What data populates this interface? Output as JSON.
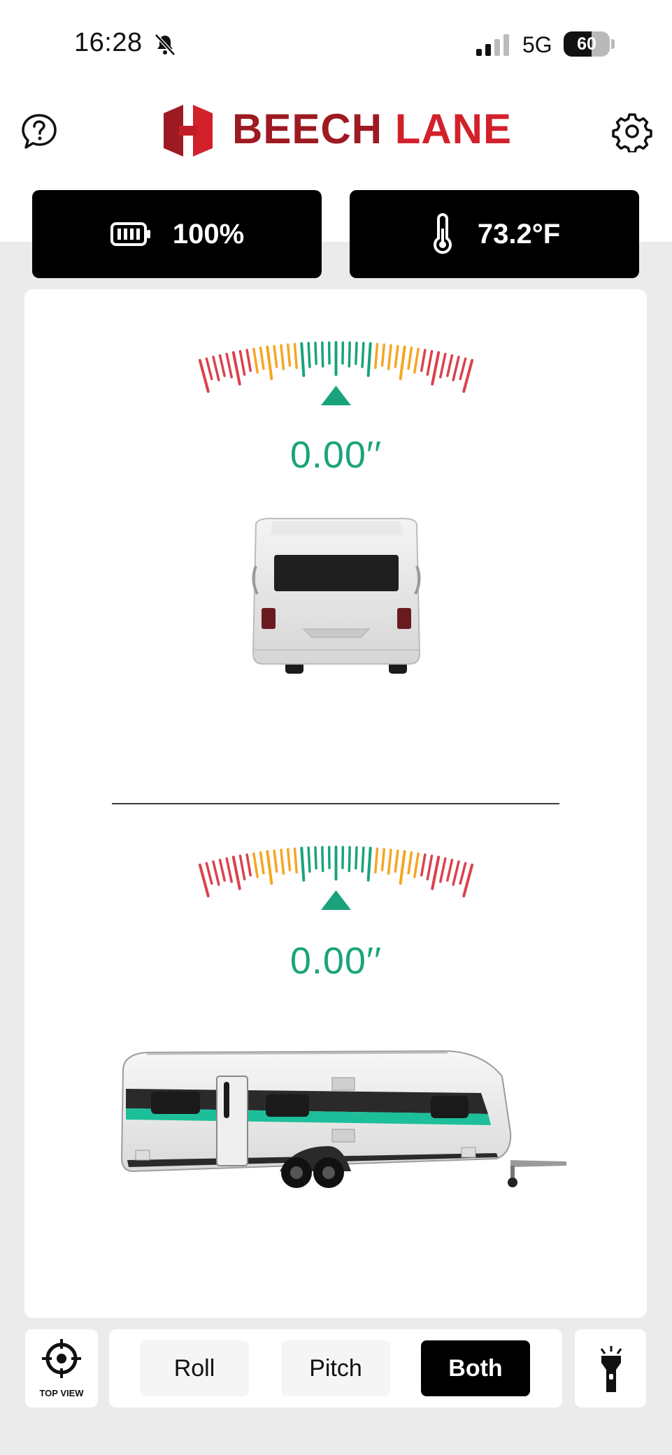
{
  "status_bar": {
    "time": "16:28",
    "network": "5G",
    "battery_level": "60",
    "battery_fraction": 0.6
  },
  "header": {
    "brand_part1": "BEECH",
    "brand_part2": "LANE"
  },
  "stats": {
    "battery": "100%",
    "temperature": "73.2°F"
  },
  "roll": {
    "reading": "0.00′′"
  },
  "pitch": {
    "reading": "0.00′′"
  },
  "bottom_bar": {
    "top_view_label": "TOP VIEW",
    "modes": [
      "Roll",
      "Pitch",
      "Both"
    ],
    "selected_mode": "Both"
  },
  "colors": {
    "brand_dark_red": "#9e1a22",
    "brand_red": "#d3212c",
    "gauge_green": "#1aa37a",
    "gauge_orange": "#f5a623",
    "gauge_red": "#d9434e",
    "accent_teal": "#1dbf9a"
  },
  "icons": [
    "bell-slash-icon",
    "signal-icon",
    "help-icon",
    "gear-icon",
    "battery-icon",
    "thermometer-icon",
    "crosshair-icon",
    "flashlight-icon"
  ]
}
